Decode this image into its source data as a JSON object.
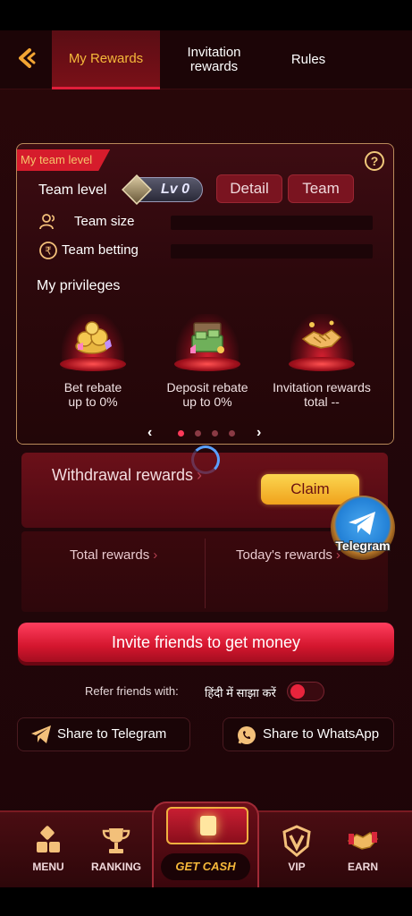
{
  "header": {
    "tabs": [
      {
        "label": "My Rewards",
        "active": true
      },
      {
        "label": "Invitation rewards",
        "active": false
      },
      {
        "label": "Rules",
        "active": false
      }
    ]
  },
  "team_card": {
    "tag": "My team level",
    "team_level_label": "Team level",
    "level_badge": "Lv 0",
    "detail_button": "Detail",
    "team_button": "Team",
    "team_size_label": "Team size",
    "team_betting_label": "Team betting",
    "privileges_title": "My privileges",
    "privileges": [
      {
        "line1": "Bet rebate",
        "line2": "up to 0%",
        "icon": "coins-gems-icon"
      },
      {
        "line1": "Deposit rebate",
        "line2": "up to 0%",
        "icon": "cash-chest-icon"
      },
      {
        "line1": "Invitation rewards",
        "line2": "total --",
        "icon": "handshake-icon"
      }
    ],
    "pager": {
      "count": 4,
      "active_index": 0
    }
  },
  "withdrawal": {
    "label": "Withdrawal rewards",
    "claim_button": "Claim"
  },
  "totals": {
    "total_rewards": "Total rewards",
    "todays_rewards": "Today's rewards"
  },
  "telegram_float": {
    "label": "Telegram"
  },
  "invite_button": "Invite friends to get money",
  "refer": {
    "label": "Refer friends with:",
    "hindi": "हिंदी में साझा करें"
  },
  "share": {
    "telegram": "Share to Telegram",
    "whatsapp": "Share to WhatsApp"
  },
  "bottom_nav": {
    "menu": "MENU",
    "ranking": "RANKING",
    "get_cash": "GET CASH",
    "vip": "VIP",
    "earn": "EARN"
  },
  "colors": {
    "accent_gold": "#f5b83a",
    "primary_red": "#d4162e",
    "background": "#22060a"
  }
}
